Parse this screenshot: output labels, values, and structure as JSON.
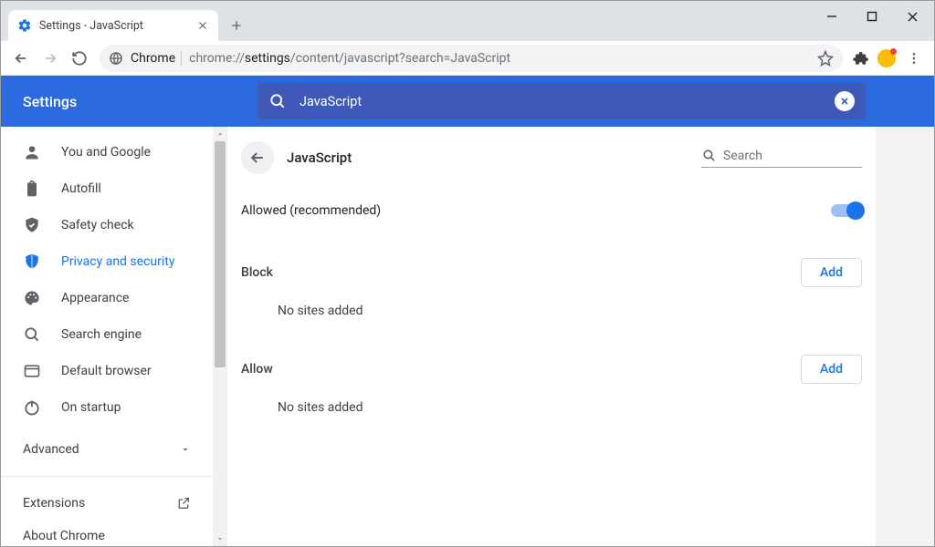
{
  "tab": {
    "title": "Settings - JavaScript"
  },
  "omnibox": {
    "prefix": "Chrome",
    "seg1": "chrome://",
    "seg2": "settings",
    "seg3": "/content/javascript?search=JavaScript"
  },
  "bluebar": {
    "title": "Settings",
    "search_value": "JavaScript"
  },
  "sidebar": {
    "items": [
      {
        "label": "You and Google"
      },
      {
        "label": "Autofill"
      },
      {
        "label": "Safety check"
      },
      {
        "label": "Privacy and security"
      },
      {
        "label": "Appearance"
      },
      {
        "label": "Search engine"
      },
      {
        "label": "Default browser"
      },
      {
        "label": "On startup"
      }
    ],
    "advanced": "Advanced",
    "extensions": "Extensions",
    "about": "About Chrome"
  },
  "page": {
    "title": "JavaScript",
    "search_placeholder": "Search",
    "allowed_label": "Allowed (recommended)",
    "block_title": "Block",
    "allow_title": "Allow",
    "empty": "No sites added",
    "add": "Add"
  }
}
